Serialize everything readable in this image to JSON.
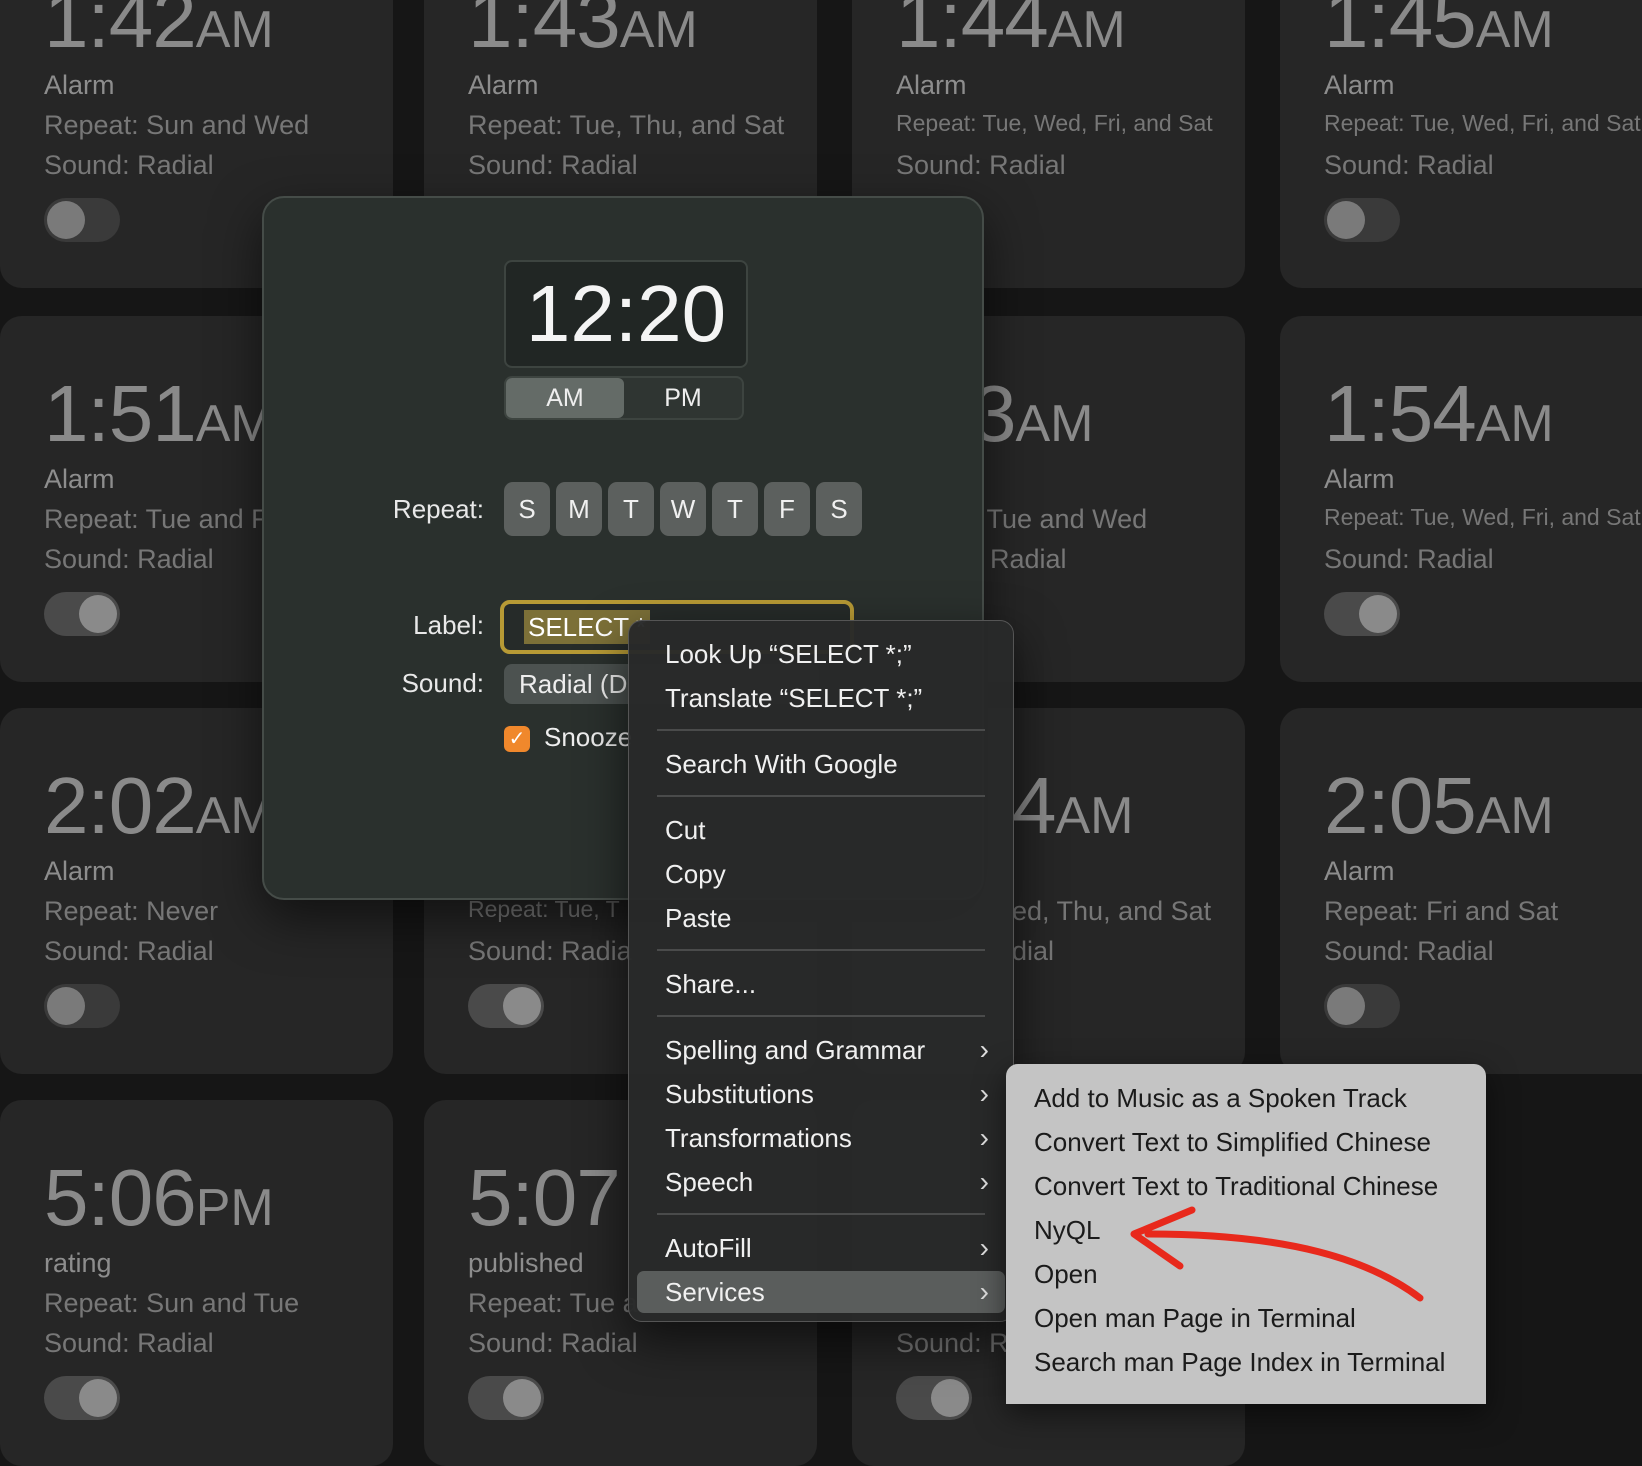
{
  "cards": [
    {
      "time": "1:42",
      "ampm": "AM",
      "label": "Alarm",
      "repeat": "Repeat: Sun and Wed",
      "sound": "Sound: Radial",
      "on": false
    },
    {
      "time": "1:43",
      "ampm": "AM",
      "label": "Alarm",
      "repeat": "Repeat: Tue, Thu, and Sat",
      "sound": "Sound: Radial",
      "on": false
    },
    {
      "time": "1:44",
      "ampm": "AM",
      "label": "Alarm",
      "repeat": "Repeat: Tue, Wed, Fri, and Sat",
      "sound": "Sound: Radial",
      "on": false
    },
    {
      "time": "1:45",
      "ampm": "AM",
      "label": "Alarm",
      "repeat": "Repeat: Tue, Wed, Fri, and Sat",
      "sound": "Sound: Radial",
      "on": false
    },
    {
      "time": "1:51",
      "ampm": "AM",
      "label": "Alarm",
      "repeat": "Repeat: Tue and F",
      "sound": "Sound: Radial",
      "on": true
    },
    {
      "time": "",
      "ampm": "",
      "label": "",
      "repeat": "",
      "sound": "",
      "on": false
    },
    {
      "time": "3",
      "ampm": "AM",
      "label": "",
      "repeat": ": Tue and Wed",
      "sound": "Radial",
      "on": false
    },
    {
      "time": "1:54",
      "ampm": "AM",
      "label": "Alarm",
      "repeat": "Repeat: Tue, Wed, Fri, and Sat",
      "sound": "Sound: Radial",
      "on": true
    },
    {
      "time": "2:02",
      "ampm": "AM",
      "label": "Alarm",
      "repeat": "Repeat: Never",
      "sound": "Sound: Radial",
      "on": false
    },
    {
      "time": "",
      "ampm": "",
      "label": "",
      "repeat": "Repeat: Tue, T",
      "sound": "Sound: Radia",
      "on": true
    },
    {
      "time": "4",
      "ampm": "AM",
      "label": "",
      "repeat": "ed, Thu, and Sat",
      "sound": "dial",
      "on": false
    },
    {
      "time": "2:05",
      "ampm": "AM",
      "label": "Alarm",
      "repeat": "Repeat: Fri and Sat",
      "sound": "Sound: Radial",
      "on": false
    },
    {
      "time": "5:06",
      "ampm": "PM",
      "label": "rating",
      "repeat": "Repeat: Sun and Tue",
      "sound": "Sound: Radial",
      "on": true
    },
    {
      "time": "5:07",
      "ampm": "",
      "label": "published",
      "repeat": "Repeat: Tue a",
      "sound": "Sound: Radial",
      "on": true
    },
    {
      "time": "",
      "ampm": "",
      "label": "",
      "repeat": "",
      "sound": "Sound: R",
      "on": true
    },
    {
      "time": "",
      "ampm": "",
      "label": "",
      "repeat": "",
      "sound": "",
      "on": false
    }
  ],
  "dialog": {
    "time": "12:20",
    "am": "AM",
    "pm": "PM",
    "repeat_label": "Repeat:",
    "days": [
      "S",
      "M",
      "T",
      "W",
      "T",
      "F",
      "S"
    ],
    "label_label": "Label:",
    "label_value": "SELECT *",
    "sound_label": "Sound:",
    "sound_value": "Radial (D",
    "snooze_label": "Snooze"
  },
  "context_menu": {
    "items": [
      {
        "label": "Look Up “SELECT *;”",
        "sub": false
      },
      {
        "label": "Translate “SELECT *;”",
        "sub": false
      },
      {
        "label": "Search With Google",
        "sub": false
      },
      {
        "label": "Cut",
        "sub": false
      },
      {
        "label": "Copy",
        "sub": false
      },
      {
        "label": "Paste",
        "sub": false
      },
      {
        "label": "Share...",
        "sub": false
      },
      {
        "label": "Spelling and Grammar",
        "sub": true
      },
      {
        "label": "Substitutions",
        "sub": true
      },
      {
        "label": "Transformations",
        "sub": true
      },
      {
        "label": "Speech",
        "sub": true
      },
      {
        "label": "AutoFill",
        "sub": true
      },
      {
        "label": "Services",
        "sub": true
      }
    ],
    "chevron": "›"
  },
  "services_submenu": {
    "items": [
      "Add to Music as a Spoken Track",
      "Convert Text to Simplified Chinese",
      "Convert Text to Traditional Chinese",
      "NyQL",
      "Open",
      "Open man Page in Terminal",
      "Search man Page Index in Terminal"
    ]
  },
  "colors": {
    "accent_orange": "#f0882c",
    "selection": "#7c7038",
    "focus_ring": "#b79a35",
    "annotation_arrow": "#e8291c"
  }
}
